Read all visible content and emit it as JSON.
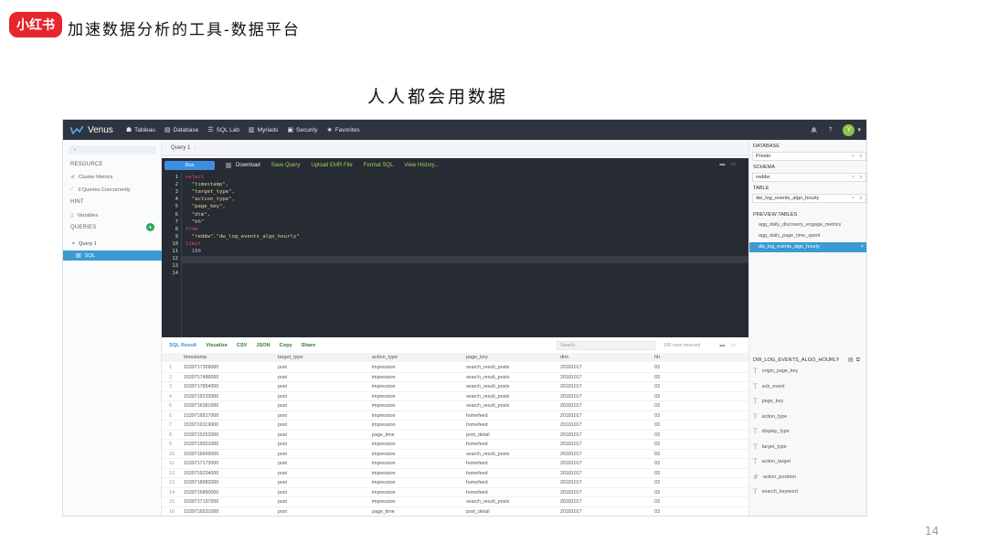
{
  "slide": {
    "logo_text": "小红书",
    "title": "加速数据分析的工具-数据平台",
    "subtitle": "人人都会用数据",
    "page_number": "14"
  },
  "app": {
    "brand": "Venus",
    "nav": [
      {
        "label": "Tableau",
        "icon": "tableau-icon",
        "glyph": "☗"
      },
      {
        "label": "Database",
        "icon": "database-icon",
        "glyph": "▤"
      },
      {
        "label": "SQL Lab",
        "icon": "sql-lab-icon",
        "glyph": "☰"
      },
      {
        "label": "Myriads",
        "icon": "chart-icon",
        "glyph": "▥"
      },
      {
        "label": "Security",
        "icon": "security-icon",
        "glyph": "▣"
      },
      {
        "label": "Favorites",
        "icon": "star-icon",
        "glyph": "★"
      }
    ],
    "nav_right": {
      "bell": "🔔",
      "help": "?",
      "avatar": "Y",
      "avatar_caret": "▾"
    },
    "sidebar": {
      "collapse": "‹",
      "resource_header": "RESOURCE",
      "cluster_metrics": "Cluster Metrics",
      "queries_concurrently": "3 Queries Concurrently",
      "hint_header": "HINT",
      "variables": "Variables",
      "queries_header": "QUERIES",
      "add": "+",
      "query_item": "Query 1",
      "sql_item": "SQL"
    },
    "query_tab": "Query 1",
    "query_tab_more": "›",
    "toolbar": {
      "run": "Run",
      "download": "Download",
      "save_query": "Save Query",
      "upload_emr": "Upload EMR File",
      "format_sql": "Format SQL",
      "view_history": "View History..."
    },
    "code_lines": [
      {
        "n": "1",
        "text": "select",
        "cls": "kw",
        "indent": ""
      },
      {
        "n": "2",
        "text": "\"timestamp\",",
        "cls": "str",
        "indent": "  "
      },
      {
        "n": "3",
        "text": "\"target_type\",",
        "cls": "str",
        "indent": "  "
      },
      {
        "n": "4",
        "text": "\"action_type\",",
        "cls": "str",
        "indent": "  "
      },
      {
        "n": "5",
        "text": "\"page_key\",",
        "cls": "str",
        "indent": "  "
      },
      {
        "n": "6",
        "text": "\"dtm\",",
        "cls": "str",
        "indent": "  "
      },
      {
        "n": "7",
        "text": "\"hh\"",
        "cls": "str",
        "indent": "  "
      },
      {
        "n": "8",
        "text": "from",
        "cls": "kw",
        "indent": ""
      },
      {
        "n": "9",
        "text": "\"reddw\".\"dw_log_events_algo_hourly\"",
        "cls": "str",
        "indent": "  "
      },
      {
        "n": "10",
        "text": "limit",
        "cls": "kw",
        "indent": ""
      },
      {
        "n": "11",
        "text": "100",
        "cls": "num",
        "indent": "  "
      },
      {
        "n": "12",
        "text": "",
        "cls": "",
        "indent": ""
      },
      {
        "n": "13",
        "text": "",
        "cls": "",
        "indent": ""
      },
      {
        "n": "14",
        "text": "",
        "cls": "",
        "indent": ""
      }
    ],
    "results": {
      "tabs": [
        "SQL Result",
        "Visualize",
        "CSV",
        "JSON",
        "Copy",
        "Share"
      ],
      "search_placeholder": "Search...",
      "count": "100 rows returned",
      "columns": [
        "timestamp",
        "target_type",
        "action_type",
        "page_key",
        "dtm",
        "hh"
      ],
      "rows": [
        [
          "1",
          "1539717309000",
          "post",
          "impression",
          "search_result_posts",
          "20181017",
          "03"
        ],
        [
          "2",
          "1539717486000",
          "post",
          "impression",
          "search_result_posts",
          "20181017",
          "03"
        ],
        [
          "3",
          "1539717854000",
          "post",
          "impression",
          "search_result_posts",
          "20181017",
          "03"
        ],
        [
          "4",
          "1539719233000",
          "post",
          "impression",
          "search_result_posts",
          "20181017",
          "03"
        ],
        [
          "5",
          "1539716381000",
          "post",
          "impression",
          "search_result_posts",
          "20181017",
          "03"
        ],
        [
          "6",
          "1539716817000",
          "post",
          "impression",
          "homefeed",
          "20181017",
          "03"
        ],
        [
          "7",
          "1539719119000",
          "post",
          "impression",
          "homefeed",
          "20181017",
          "03"
        ],
        [
          "8",
          "1539719252000",
          "post",
          "page_time",
          "post_detail",
          "20181017",
          "03"
        ],
        [
          "9",
          "1539719021000",
          "post",
          "impression",
          "homefeed",
          "20181017",
          "03"
        ],
        [
          "10",
          "1539716669000",
          "post",
          "impression",
          "search_result_posts",
          "20181017",
          "03"
        ],
        [
          "11",
          "1539717173000",
          "post",
          "impression",
          "homefeed",
          "20181017",
          "03"
        ],
        [
          "12",
          "1539719234000",
          "post",
          "impression",
          "homefeed",
          "20181017",
          "03"
        ],
        [
          "13",
          "1539718982000",
          "post",
          "impression",
          "homefeed",
          "20181017",
          "03"
        ],
        [
          "14",
          "1539716850000",
          "post",
          "impression",
          "homefeed",
          "20181017",
          "03"
        ],
        [
          "15",
          "1539717197000",
          "post",
          "impression",
          "search_result_posts",
          "20181017",
          "03"
        ],
        [
          "16",
          "1539716531000",
          "post",
          "page_time",
          "post_detail",
          "20181017",
          "03"
        ]
      ]
    },
    "right_panel": {
      "database_label": "DATABASE",
      "database_value": "Presto",
      "schema_label": "SCHEMA",
      "schema_value": "reddw",
      "table_label": "TABLE",
      "table_value": "dw_log_events_algo_hourly",
      "clear": "×",
      "chevron": "∨",
      "preview_label": "PREVIEW TABLES",
      "preview_tables": [
        "agg_daily_discovery_engage_metrics",
        "agg_daily_page_time_spent"
      ],
      "preview_active": "dw_log_events_algo_hourly",
      "close": "×",
      "columns_header": "DW_LOG_EVENTS_ALGO_HOURLY",
      "columns": [
        {
          "name": "origin_page_key",
          "glyph": "T"
        },
        {
          "name": "sub_event",
          "glyph": "T"
        },
        {
          "name": "page_key",
          "glyph": "T"
        },
        {
          "name": "action_type",
          "glyph": "T"
        },
        {
          "name": "display_type",
          "glyph": "T"
        },
        {
          "name": "target_type",
          "glyph": "T"
        },
        {
          "name": "action_target",
          "glyph": "T"
        },
        {
          "name": "action_position",
          "glyph": "#"
        },
        {
          "name": "search_keyword",
          "glyph": "T"
        }
      ]
    }
  }
}
